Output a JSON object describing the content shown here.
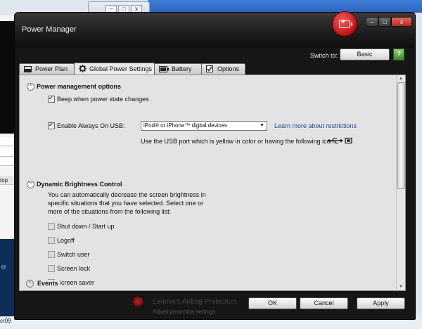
{
  "window": {
    "title": "Power Manager",
    "switch_to_label": "Switch to:",
    "switch_to_button": "Basic",
    "help_glyph": "?",
    "minimize_glyph": "–",
    "maximize_glyph": "□",
    "close_glyph": "x"
  },
  "tabs": [
    {
      "label": "Power Plan",
      "icon": "battery-outline-icon"
    },
    {
      "label": "Global Power Settings",
      "icon": "gear-icon",
      "active": true
    },
    {
      "label": "Battery",
      "icon": "battery-icon"
    },
    {
      "label": "Options",
      "icon": "checkbox-icon"
    }
  ],
  "power_management": {
    "header": "Power management options",
    "beep_label": "Beep when power state changes",
    "beep_checked": true,
    "usb_label": "Enable Always On USB:",
    "usb_checked": true,
    "usb_select_value": "iPod® or iPhone™ digital devices",
    "learn_more_link": "Learn more about restrictions",
    "usb_hint": "Use the USB port which is yellow in color or having the following icon."
  },
  "dynamic_brightness": {
    "header": "Dynamic Brightness Control",
    "description_line1": "You can automatically decrease the screen brightness in",
    "description_line2": "specific situations that you have selected. Select one or",
    "description_line3": "more of the situations from the following list:",
    "options": [
      {
        "label": "Shut down / Start up",
        "checked": false
      },
      {
        "label": "Logoff",
        "checked": false
      },
      {
        "label": "Switch user",
        "checked": false
      },
      {
        "label": "Screen lock",
        "checked": false
      },
      {
        "label": "Screen saver",
        "checked": false
      }
    ]
  },
  "events": {
    "header": "Events"
  },
  "buttons": {
    "ok": "OK",
    "cancel": "Cancel",
    "apply": "Apply"
  },
  "background": {
    "airbag_title": "Lenovo's Airbag Protection",
    "airbag_subtitle": "Adjust protection settings",
    "left_label_1": "top",
    "left_label_2": "cr",
    "left_label_3": "cr09",
    "bottom_label": "cr09"
  },
  "colors": {
    "window_frame": "#161616",
    "panel_bg": "#e3e3e3",
    "link": "#1a4fa0",
    "badge_red": "#c01010",
    "help_green": "#3d8b26"
  }
}
